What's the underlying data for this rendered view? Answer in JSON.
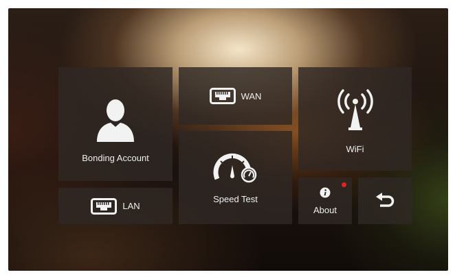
{
  "tiles": {
    "bonding_account": {
      "label": "Bonding Account",
      "icon": "user-icon"
    },
    "wan": {
      "label": "WAN",
      "icon": "ethernet-port-icon"
    },
    "wifi": {
      "label": "WiFi",
      "icon": "wifi-antenna-icon"
    },
    "speed_test": {
      "label": "Speed Test",
      "icon": "speedometer-icon"
    },
    "lan": {
      "label": "LAN",
      "icon": "ethernet-port-icon"
    },
    "about": {
      "label": "About",
      "icon": "info-icon",
      "has_notification": true,
      "badge_color": "#e52222"
    },
    "back": {
      "icon": "back-arrow-icon"
    }
  }
}
